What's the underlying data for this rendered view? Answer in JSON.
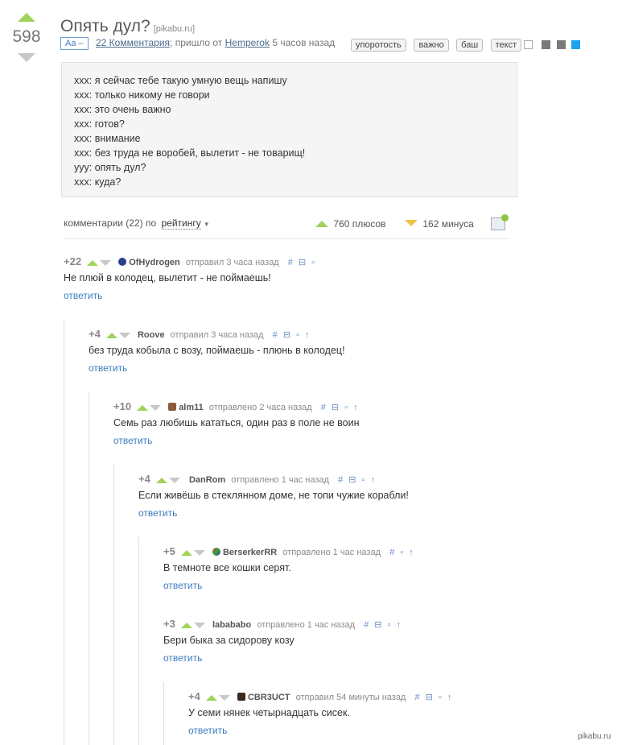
{
  "post": {
    "rating": "598",
    "title": "Опять дул?",
    "source": "[pikabu.ru]",
    "aa_label": "Aa –",
    "comments_link": "22 Комментария",
    "meta_mid": "; пришло от",
    "author": "Hemperok",
    "time": "5 часов назад",
    "tags": [
      "упоротость",
      "важно",
      "баш",
      "текст"
    ],
    "share_icons": [
      "save-icon",
      "facebook-icon",
      "vk-icon",
      "twitter-icon"
    ],
    "story_lines": [
      "xxx: я сейчас тебе такую умную вещь напишу",
      "xxx: только никому не говори",
      "xxx: это очень важно",
      "xxx: готов?",
      "xxx: внимание",
      "xxx: без труда не воробей, вылетит - не товарищ!",
      "yyy: опять дул?",
      "xxx: куда?"
    ]
  },
  "comments_bar": {
    "label": "комментарии (22) по",
    "sort": "рейтингу",
    "pluses": "760 плюсов",
    "minuses": "162 минуса"
  },
  "comments": [
    {
      "score": "+22",
      "user": "OfHydrogen",
      "action": "отправил 3 часа назад",
      "text": "Не плюй в колодец, вылетит - не поймаешь!",
      "reply": "ответить"
    },
    {
      "score": "+4",
      "user": "Roove",
      "action": "отправил 3 часа назад",
      "text": "без труда кобыла с возу, поймаешь - плюнь в колодец!",
      "reply": "ответить"
    },
    {
      "score": "+10",
      "user": "alm11",
      "action": "отправлено 2 часа назад",
      "text": "Семь раз любишь кататься, один раз в поле не воин",
      "reply": "ответить"
    },
    {
      "score": "+4",
      "user": "DanRom",
      "action": "отправлено 1 час назад",
      "text": "Если живёшь в стеклянном доме, не топи чужие корабли!",
      "reply": "ответить"
    },
    {
      "score": "+5",
      "user": "BerserkerRR",
      "action": "отправлено 1 час назад",
      "text": "В темноте все кошки серят.",
      "reply": "ответить"
    },
    {
      "score": "+3",
      "user": "labababo",
      "action": "отправлено 1 час назад",
      "text": "Бери быка за сидорову козу",
      "reply": "ответить"
    },
    {
      "score": "+4",
      "user": "CBR3UCT",
      "action": "отправил 54 минуты назад",
      "text": "У семи нянек четырнадцать сисек.",
      "reply": "ответить"
    }
  ],
  "watermark": "pikabu.ru",
  "colors": {
    "accent_green": "#9fd45a",
    "minus_yellow": "#f0c24a",
    "link_blue": "#3d7cbf"
  }
}
